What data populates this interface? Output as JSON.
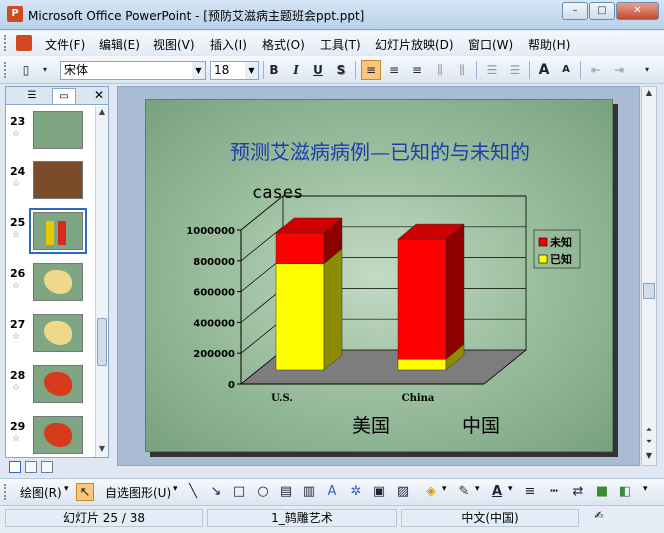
{
  "window": {
    "app_title": "Microsoft Office PowerPoint - [预防艾滋病主题班会ppt.ppt]",
    "app_icon_letter": "P",
    "min_glyph": "–",
    "max_glyph": "□",
    "close_glyph": "✕"
  },
  "menu": [
    "文件(F)",
    "编辑(E)",
    "视图(V)",
    "插入(I)",
    "格式(O)",
    "工具(T)",
    "幻灯片放映(D)",
    "窗口(W)",
    "帮助(H)"
  ],
  "toolbar": {
    "font_name": "宋体",
    "font_size": "18",
    "bold": "B",
    "italic": "I",
    "underline": "U",
    "shadow": "S",
    "grow_font": "A",
    "shrink_font": "A"
  },
  "pane": {
    "close_glyph": "✕",
    "slides": [
      {
        "num": "23",
        "icon": "☆",
        "kind": "text"
      },
      {
        "num": "24",
        "icon": "☆",
        "kind": "photo"
      },
      {
        "num": "25",
        "icon": "☆",
        "kind": "bars",
        "selected": true
      },
      {
        "num": "26",
        "icon": "☆",
        "kind": "map"
      },
      {
        "num": "27",
        "icon": "☆",
        "kind": "map"
      },
      {
        "num": "28",
        "icon": "☆",
        "kind": "map-red"
      },
      {
        "num": "29",
        "icon": "☆",
        "kind": "map-red"
      }
    ]
  },
  "slide": {
    "title": "预测艾滋病病例—已知的与未知的",
    "ylabel": "cases",
    "cn_labels": [
      "美国",
      "中国"
    ]
  },
  "chart_data": {
    "type": "bar",
    "stacked": true,
    "three_d": true,
    "categories": [
      "U.S.",
      "China"
    ],
    "series": [
      {
        "name": "已知",
        "values": [
          690000,
          70000
        ],
        "color": "#ffff00"
      },
      {
        "name": "未知",
        "values": [
          200000,
          780000
        ],
        "color": "#ff0000"
      }
    ],
    "ylabel": "cases",
    "ylim": [
      0,
      1000000
    ],
    "yticks": [
      "0",
      "200000",
      "400000",
      "600000",
      "800000",
      "1000000"
    ],
    "legend_order": [
      "未知",
      "已知"
    ],
    "legend": "right",
    "grid": true
  },
  "drawbar": {
    "draw_label": "绘图(R)",
    "autoshapes_label": "自选图形(U)"
  },
  "status": {
    "slide_info": "幻灯片 25 / 38",
    "design": "1_鸫雕艺术",
    "language": "中文(中国)"
  }
}
